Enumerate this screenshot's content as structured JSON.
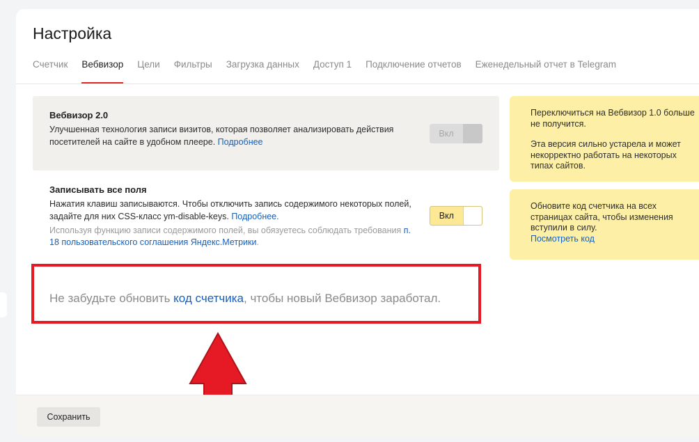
{
  "page": {
    "title": "Настройка"
  },
  "tabs": [
    {
      "label": "Счетчик"
    },
    {
      "label": "Вебвизор"
    },
    {
      "label": "Цели"
    },
    {
      "label": "Фильтры"
    },
    {
      "label": "Загрузка данных"
    },
    {
      "label": "Доступ 1"
    },
    {
      "label": "Подключение отчетов"
    },
    {
      "label": "Еженедельный отчет в Telegram"
    }
  ],
  "active_tab": "Вебвизор",
  "webvisor2": {
    "title": "Вебвизор 2.0",
    "description": "Улучшенная технология записи визитов, которая позволяет анализировать действия посетителей на сайте в удобном плеере.",
    "more_link": "Подробнее",
    "toggle_label": "Вкл",
    "toggle_state": "disabled"
  },
  "record_fields": {
    "title": "Записывать все поля",
    "description": "Нажатия клавиш записываются. Чтобы отключить запись содержимого некоторых полей, задайте для них CSS-класс ym-disable-keys.",
    "more_link": "Подробнее.",
    "notice_prefix": "Используя функцию записи содержимого полей, вы обязуетесь соблюдать требования",
    "notice_link": "п. 18 пользовательского соглашения Яндекс.Метрики",
    "notice_suffix": ".",
    "toggle_label": "Вкл",
    "toggle_state": "on"
  },
  "reminder": {
    "prefix": "Не забудьте обновить",
    "link": "код счетчика",
    "suffix": ", чтобы новый Вебвизор заработал."
  },
  "sidebar": {
    "warning_line1": "Переключиться на Вебвизор 1.0 больше не получится.",
    "warning_line2": "Эта версия сильно устарела и может некорректно работать на некоторых типах сайтов.",
    "update_text": "Обновите код счетчика на всех страницах сайта, чтобы изменения вступили в силу.",
    "update_link": "Посмотреть код"
  },
  "footer": {
    "save_label": "Сохранить"
  },
  "colors": {
    "accent_red": "#e02828",
    "link_blue": "#1560bd",
    "sidebar_yellow": "#fdf0a6",
    "toggle_on_yellow": "#fde896",
    "annotation_red": "#e51a24"
  }
}
